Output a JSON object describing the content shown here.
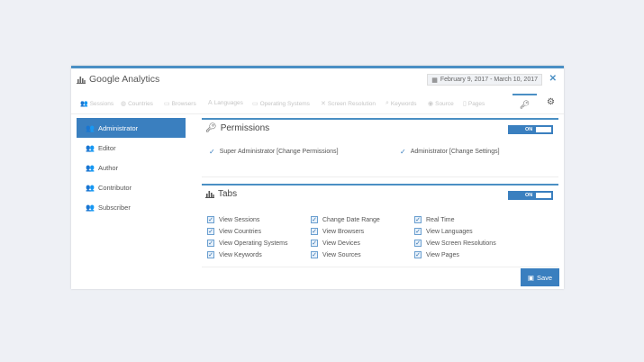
{
  "header": {
    "title": "Google Analytics",
    "title_icon": "bar-chart-icon",
    "date_icon": "calendar-icon",
    "date_range": "February 9, 2017 - March 10, 2017",
    "close_icon": "close-icon"
  },
  "tabs": [
    {
      "label": "Sessions",
      "icon": "users-icon"
    },
    {
      "label": "Countries",
      "icon": "globe-icon"
    },
    {
      "label": "Browsers",
      "icon": "window-icon"
    },
    {
      "label": "Languages",
      "icon": "language-icon"
    },
    {
      "label": "Operating Systems",
      "icon": "desktop-icon"
    },
    {
      "label": "Screen Resolution",
      "icon": "expand-icon"
    },
    {
      "label": "Keywords",
      "icon": "search-icon"
    },
    {
      "label": "Source",
      "icon": "source-icon"
    },
    {
      "label": "Pages",
      "icon": "file-icon"
    }
  ],
  "sidebar": {
    "items": [
      {
        "label": "Administrator",
        "active": true
      },
      {
        "label": "Editor",
        "active": false
      },
      {
        "label": "Author",
        "active": false
      },
      {
        "label": "Contributor",
        "active": false
      },
      {
        "label": "Subscriber",
        "active": false
      }
    ]
  },
  "permissions": {
    "title": "Permissions",
    "toggle": "ON",
    "items": [
      "Super Administrator [Change Permissions]",
      "Administrator [Change Settings]"
    ]
  },
  "tabs_section": {
    "title": "Tabs",
    "toggle": "ON",
    "columns": [
      [
        "View Sessions",
        "View Countries",
        "View Operating Systems",
        "View Keywords"
      ],
      [
        "Change Date Range",
        "View Browsers",
        "View Devices",
        "View Sources"
      ],
      [
        "Real Time",
        "View Languages",
        "View Screen Resolutions",
        "View Pages"
      ]
    ]
  },
  "save_label": "Save",
  "colors": {
    "accent": "#3a7fbf",
    "background": "#eef0f5"
  }
}
